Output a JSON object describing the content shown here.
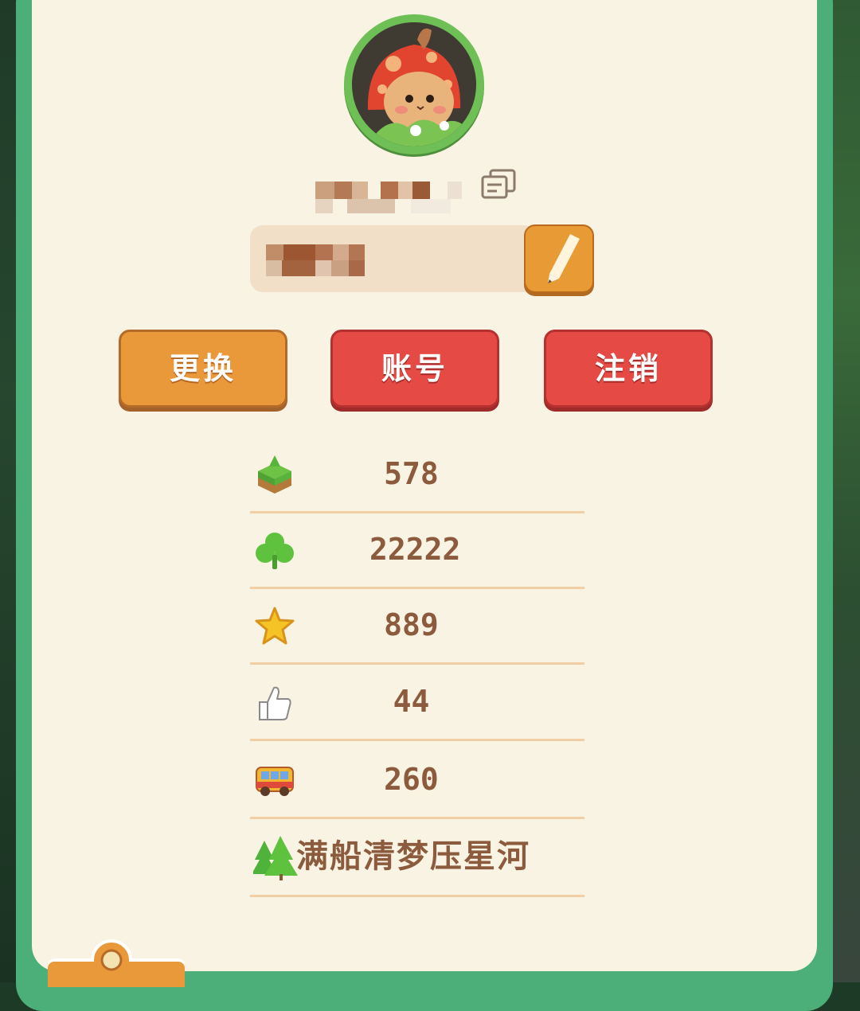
{
  "profile": {
    "avatar_icon": "mushroom-bunny-avatar-icon",
    "copy_icon": "copy-icon",
    "edit_icon": "pencil-icon"
  },
  "buttons": {
    "change": "更换",
    "account": "账号",
    "logout": "注销"
  },
  "stats": [
    {
      "icon": "grass-block-icon",
      "value": "578"
    },
    {
      "icon": "clover-icon",
      "value": "22222"
    },
    {
      "icon": "star-icon",
      "value": "889"
    },
    {
      "icon": "thumbs-up-icon",
      "value": "44"
    },
    {
      "icon": "bus-icon",
      "value": "260"
    }
  ],
  "motto": {
    "icon": "pine-tree-icon",
    "text": "满船清梦压星河"
  },
  "colors": {
    "panel": "#f8f3e2",
    "frame": "#4cae78",
    "orange_button": "#e9983a",
    "red_button": "#e54a45",
    "text_brown": "#8c5a3c",
    "divider": "#f1cfa6"
  }
}
